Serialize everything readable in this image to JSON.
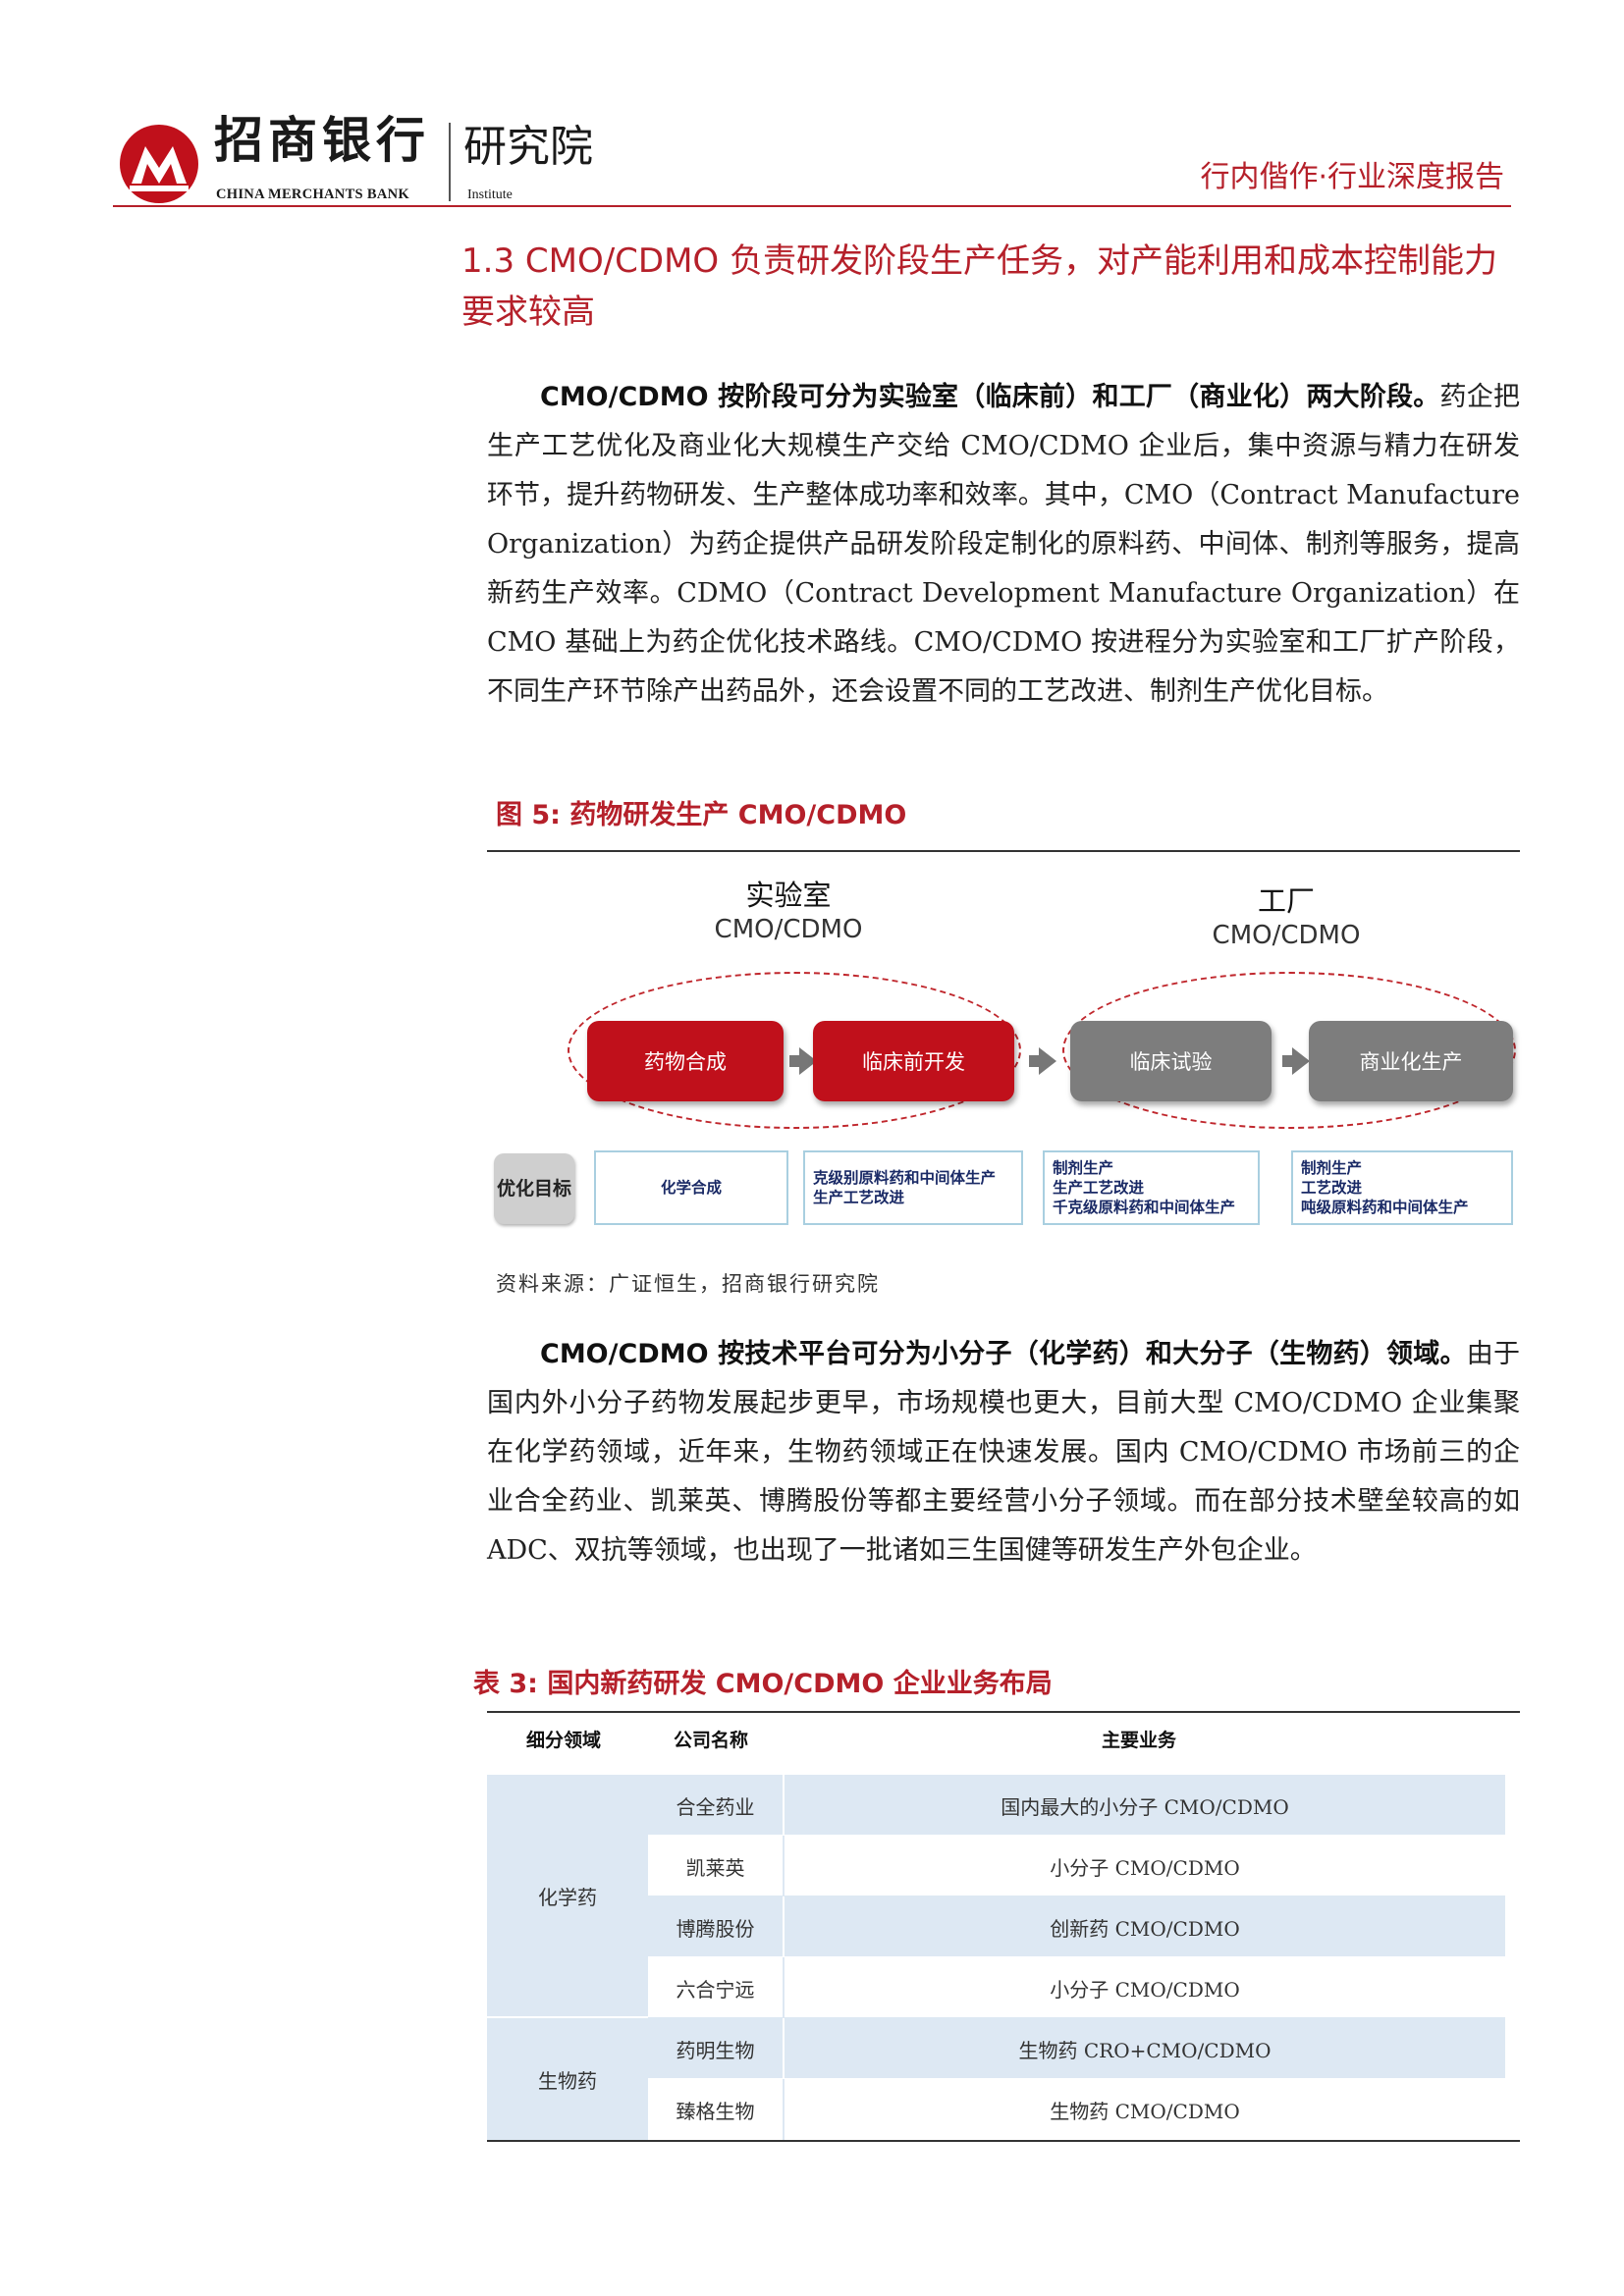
{
  "header": {
    "brand_cn": "招商银行",
    "brand_en": "CHINA MERCHANTS BANK",
    "institute_cn": "研究院",
    "institute_en": "Institute",
    "report_type": "行内偕作·行业深度报告"
  },
  "section": {
    "title": "1.3 CMO/CDMO 负责研发阶段生产任务，对产能利用和成本控制能力要求较高"
  },
  "paragraph1": {
    "lead": "CMO/CDMO 按阶段可分为实验室（临床前）和工厂（商业化）两大阶段。",
    "body": "药企把生产工艺优化及商业化大规模生产交给 CMO/CDMO 企业后，集中资源与精力在研发环节，提升药物研发、生产整体成功率和效率。其中，CMO（Contract Manufacture Organization）为药企提供产品研发阶段定制化的原料药、中间体、制剂等服务，提高新药生产效率。CDMO（Contract Development Manufacture Organization）在 CMO 基础上为药企优化技术路线。CMO/CDMO 按进程分为实验室和工厂扩产阶段，不同生产环节除产出药品外，还会设置不同的工艺改进、制剂生产优化目标。"
  },
  "figure": {
    "caption": "图 5:  药物研发生产 CMO/CDMO",
    "phase_lab": {
      "cn": "实验室",
      "en": "CMO/CDMO"
    },
    "phase_factory": {
      "cn": "工厂",
      "en": "CMO/CDMO"
    },
    "steps": [
      "药物合成",
      "临床前开发",
      "临床试验",
      "商业化生产"
    ],
    "optimization_label": "优化目标",
    "optimization_targets": [
      {
        "lines": [
          "化学合成"
        ]
      },
      {
        "lines": [
          "克级别原料药和中间体生产",
          "生产工艺改进"
        ]
      },
      {
        "lines": [
          "制剂生产",
          "生产工艺改进",
          "千克级原料药和中间体生产"
        ]
      },
      {
        "lines": [
          "制剂生产",
          "工艺改进",
          "吨级原料药和中间体生产"
        ]
      }
    ],
    "source": "资料来源：广证恒生，招商银行研究院"
  },
  "paragraph2": {
    "lead": "CMO/CDMO 按技术平台可分为小分子（化学药）和大分子（生物药）领域。",
    "body": "由于国内外小分子药物发展起步更早，市场规模也更大，目前大型 CMO/CDMO 企业集聚在化学药领域，近年来，生物药领域正在快速发展。国内 CMO/CDMO 市场前三的企业合全药业、凯莱英、博腾股份等都主要经营小分子领域。而在部分技术壁垒较高的如 ADC、双抗等领域，也出现了一批诸如三生国健等研发生产外包企业。"
  },
  "table": {
    "caption": "表 3:  国内新药研发 CMO/CDMO 企业业务布局",
    "headers": [
      "细分领域",
      "公司名称",
      "主要业务"
    ],
    "groups": [
      {
        "category": "化学药",
        "rows": [
          {
            "company": "合全药业",
            "business": "国内最大的小分子 CMO/CDMO"
          },
          {
            "company": "凯莱英",
            "business": "小分子 CMO/CDMO"
          },
          {
            "company": "博腾股份",
            "business": "创新药 CMO/CDMO"
          },
          {
            "company": "六合宁远",
            "business": "小分子 CMO/CDMO"
          }
        ]
      },
      {
        "category": "生物药",
        "rows": [
          {
            "company": "药明生物",
            "business": "生物药 CRO+CMO/CDMO"
          },
          {
            "company": "臻格生物",
            "business": "生物药 CMO/CDMO"
          }
        ]
      }
    ]
  },
  "colors": {
    "brand_red": "#b5202a",
    "step_red": "#c0101b",
    "step_gray": "#7d7d7d",
    "table_shade": "#dde8f3",
    "opt_border": "#a9cfe0"
  }
}
